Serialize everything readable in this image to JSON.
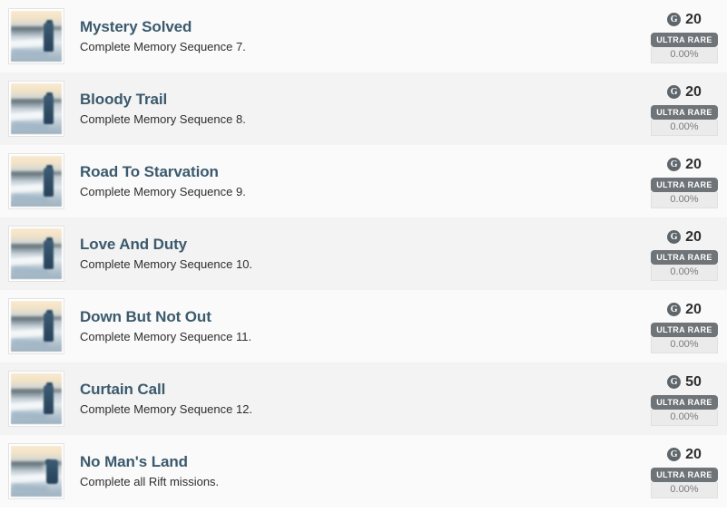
{
  "list": {
    "currency_icon": "g-coin-icon",
    "rows": [
      {
        "title": "Mystery Solved",
        "description": "Complete Memory Sequence 7.",
        "points": "20",
        "currency": "G",
        "rarity": "ULTRA RARE",
        "percent": "0.00%",
        "thumbnail": "frozen-landscape-thumbnail"
      },
      {
        "title": "Bloody Trail",
        "description": "Complete Memory Sequence 8.",
        "points": "20",
        "currency": "G",
        "rarity": "ULTRA RARE",
        "percent": "0.00%",
        "thumbnail": "frozen-landscape-thumbnail"
      },
      {
        "title": "Road To Starvation",
        "description": "Complete Memory Sequence 9.",
        "points": "20",
        "currency": "G",
        "rarity": "ULTRA RARE",
        "percent": "0.00%",
        "thumbnail": "frozen-landscape-thumbnail"
      },
      {
        "title": "Love And Duty",
        "description": "Complete Memory Sequence 10.",
        "points": "20",
        "currency": "G",
        "rarity": "ULTRA RARE",
        "percent": "0.00%",
        "thumbnail": "frozen-landscape-thumbnail"
      },
      {
        "title": "Down But Not Out",
        "description": "Complete Memory Sequence 11.",
        "points": "20",
        "currency": "G",
        "rarity": "ULTRA RARE",
        "percent": "0.00%",
        "thumbnail": "frozen-landscape-thumbnail"
      },
      {
        "title": "Curtain Call",
        "description": "Complete Memory Sequence 12.",
        "points": "50",
        "currency": "G",
        "rarity": "ULTRA RARE",
        "percent": "0.00%",
        "thumbnail": "frozen-landscape-thumbnail"
      },
      {
        "title": "No Man's Land",
        "description": "Complete all Rift missions.",
        "points": "20",
        "currency": "G",
        "rarity": "ULTRA RARE",
        "percent": "0.00%",
        "thumbnail": "frozen-landscape-thumbnail-variant"
      }
    ]
  },
  "colors": {
    "row_background": "#fafafa",
    "row_background_alt": "#f3f3f3",
    "title": "#3b5a6d",
    "description": "#2e2e2e",
    "rarity_badge": "#6f7478",
    "percent_background": "#ebebeb",
    "percent_text": "#7a7a7a",
    "currency_icon": "#5f666b"
  }
}
